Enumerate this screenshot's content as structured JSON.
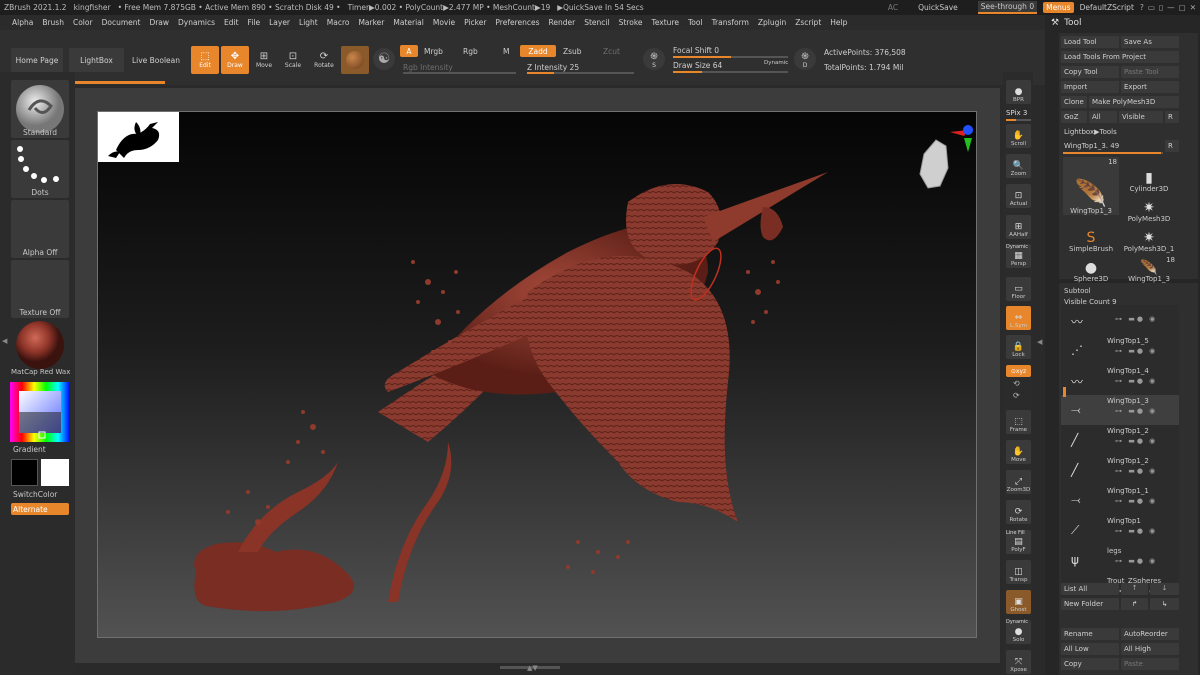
{
  "titlebar": {
    "items": [
      "ZBrush 2021.1.2",
      "kingfisher",
      "• Free Mem 7.875GB • Active Mem 890 • Scratch Disk 49 •",
      "Timer▶0.002 • PolyCount▶2.477 MP • MeshCount▶19",
      "▶QuickSave In 54 Secs"
    ],
    "ac": "AC",
    "quicksave": "QuickSave",
    "see_through_label": "See-through",
    "see_through_value": "0",
    "menus": "Menus",
    "script": "DefaultZScript",
    "controls": [
      "?",
      "▭",
      "▯",
      "—",
      "▢",
      "✕"
    ]
  },
  "menubar": [
    "Alpha",
    "Brush",
    "Color",
    "Document",
    "Draw",
    "Dynamics",
    "Edit",
    "File",
    "Layer",
    "Light",
    "Macro",
    "Marker",
    "Material",
    "Movie",
    "Picker",
    "Preferences",
    "Render",
    "Stencil",
    "Stroke",
    "Texture",
    "Tool",
    "Transform",
    "Zplugin",
    "Zscript",
    "Help"
  ],
  "toolbar": {
    "home_page": "Home Page",
    "lightbox": "LightBox",
    "live_boolean": "Live Boolean",
    "edit": "Edit",
    "draw": "Draw",
    "move": "Move",
    "scale": "Scale",
    "rotate": "Rotate",
    "a": "A",
    "mrgb": "Mrgb",
    "rgb": "Rgb",
    "m": "M",
    "rgb_intensity": "Rgb Intensity",
    "zadd": "Zadd",
    "zsub": "Zsub",
    "zcut": "Zcut",
    "z_intensity_label": "Z Intensity",
    "z_intensity": "25",
    "s_label": "S",
    "d_label": "D",
    "focal_shift_label": "Focal Shift",
    "focal_shift": "0",
    "draw_size_label": "Draw Size",
    "draw_size": "64",
    "dynamic": "Dynamic",
    "active_points_label": "ActivePoints:",
    "active_points": "376,508",
    "total_points_label": "TotalPoints:",
    "total_points": "1.794 Mil"
  },
  "left_panel": {
    "brush": "Standard",
    "stroke": "Dots",
    "alpha": "Alpha Off",
    "texture": "Texture Off",
    "material": "MatCap Red Wax",
    "gradient": "Gradient",
    "switch_color": "SwitchColor",
    "alternate": "Alternate"
  },
  "right_strip": {
    "bpr": "BPR",
    "spix_label": "SPix",
    "spix": "3",
    "buttons": [
      "Scroll",
      "Zoom",
      "Actual",
      "AAHalf",
      "Persp",
      "Floor",
      "L.Sym",
      "Lock",
      "Local",
      "Frame",
      "Move",
      "Zoom3D",
      "Rotate",
      "PolyF",
      "Transp",
      "Ghost",
      "Solo",
      "Xpose"
    ],
    "dynamic": "Dynamic",
    "line_fill": "Line Fill",
    "xyz": "⊙xyz"
  },
  "tool_panel": {
    "title": "Tool",
    "load_tool": "Load Tool",
    "save_as": "Save As",
    "load_from_project": "Load Tools From Project",
    "copy_tool": "Copy Tool",
    "paste_tool": "Paste Tool",
    "import": "Import",
    "export": "Export",
    "clone": "Clone",
    "make_polymesh": "Make PolyMesh3D",
    "goz": "GoZ",
    "all": "All",
    "visible": "Visible",
    "r": "R",
    "lightbox_tools": "Lightbox▶Tools",
    "current_tool": "WingTop1_3. 49",
    "thumbs": [
      {
        "name": "WingTop1_3",
        "count": "18",
        "icon": "wing"
      },
      {
        "name": "Cylinder3D",
        "count": "",
        "icon": "cylinder"
      },
      {
        "name": "PolyMesh3D",
        "count": "",
        "icon": "star"
      },
      {
        "name": "SimpleBrush",
        "count": "",
        "icon": "s"
      },
      {
        "name": "PolyMesh3D_1",
        "count": "",
        "icon": "star"
      },
      {
        "name": "Sphere3D",
        "count": "",
        "icon": "sphere"
      },
      {
        "name": "WingTop1_3",
        "count": "18",
        "icon": "wing"
      }
    ]
  },
  "subtool": {
    "title": "Subtool",
    "visible_count_label": "Visible Count",
    "visible_count": "9",
    "items": [
      "",
      "WingTop1_5",
      "WingTop1_4",
      "WingTop1_3",
      "WingTop1_2",
      "WingTop1_2",
      "WingTop1_1",
      "WingTop1",
      "legs",
      "Trout_ZSpheres"
    ],
    "list_all": "List All",
    "new_folder": "New Folder",
    "rename": "Rename",
    "auto_reorder": "AutoReorder",
    "all_low": "All Low",
    "all_high": "All High",
    "copy": "Copy",
    "paste": "Paste"
  },
  "colors": {
    "accent": "#e8862c",
    "panel": "#2b2b2b",
    "model": "#8a3a2e"
  }
}
